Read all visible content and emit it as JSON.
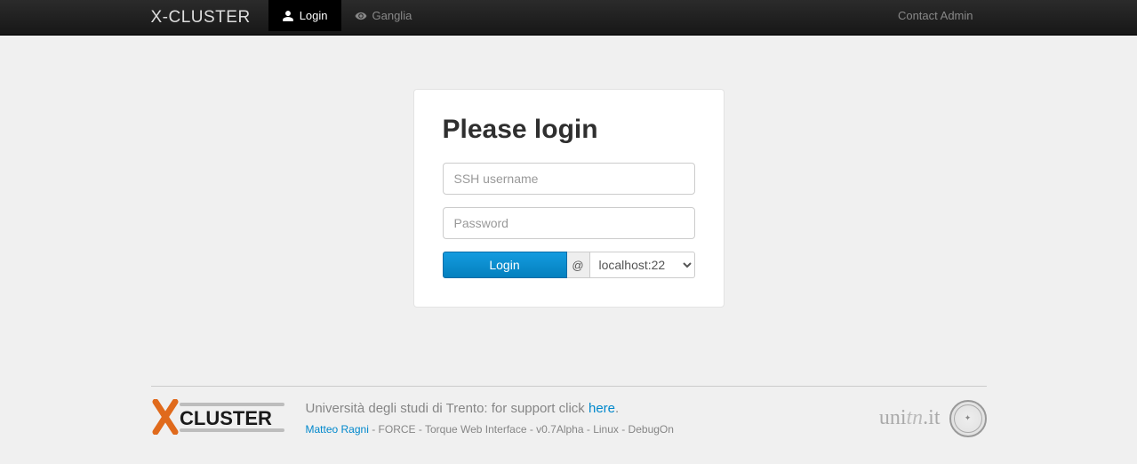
{
  "navbar": {
    "brand": "X-CLUSTER",
    "login": "Login",
    "ganglia": "Ganglia",
    "contact": "Contact Admin"
  },
  "login": {
    "heading": "Please login",
    "username_placeholder": "SSH username",
    "password_placeholder": "Password",
    "button": "Login",
    "at": "@",
    "host_selected": "localhost:22"
  },
  "footer": {
    "support_prefix": "Università degli studi di Trento: for support click ",
    "support_link": "here",
    "support_suffix": ".",
    "credits_author": "Matteo Ragni",
    "credits_rest": " - FORCE - Torque Web Interface - v0.7Alpha - Linux - DebugOn",
    "unitn_prefix": "uni",
    "unitn_italic": "tn",
    "unitn_suffix": ".it",
    "logo_text": "CLUSTER"
  }
}
